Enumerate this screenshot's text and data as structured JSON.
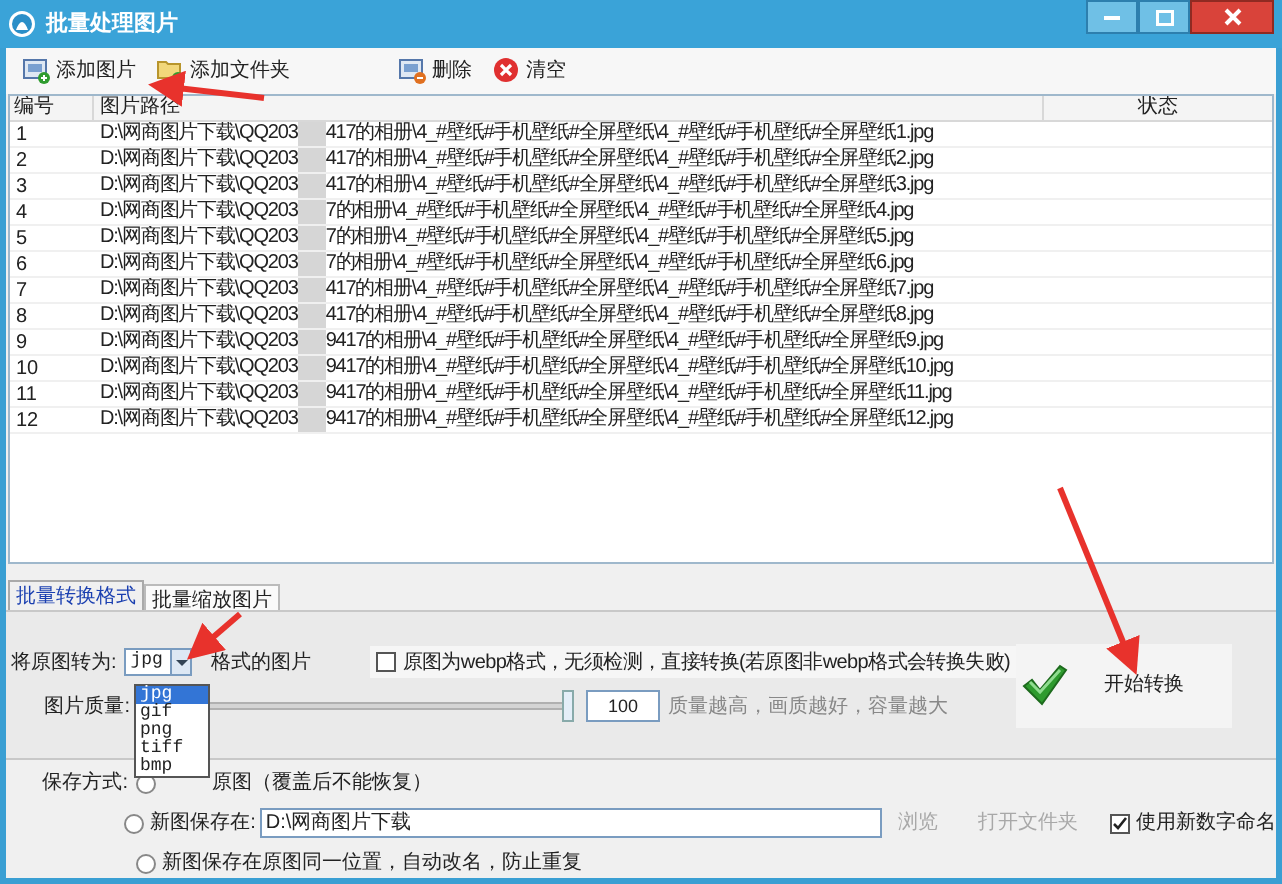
{
  "window": {
    "title": "批量处理图片"
  },
  "toolbar": [
    {
      "label": "添加图片",
      "kind": "image"
    },
    {
      "label": "添加文件夹",
      "kind": "folder"
    },
    {
      "label": "删除",
      "kind": "delete"
    },
    {
      "label": "清空",
      "kind": "clear"
    }
  ],
  "table": {
    "columns": [
      "编号",
      "图片路径",
      "状态"
    ],
    "rows": [
      {
        "number": "1",
        "path_start": "D:\\网商图片下载\\QQ203",
        "path_end": "417的相册\\4_#壁纸#手机壁纸#全屏壁纸\\4_#壁纸#手机壁纸#全屏壁纸1.jpg"
      },
      {
        "number": "2",
        "path_start": "D:\\网商图片下载\\QQ203",
        "path_end": "417的相册\\4_#壁纸#手机壁纸#全屏壁纸\\4_#壁纸#手机壁纸#全屏壁纸2.jpg"
      },
      {
        "number": "3",
        "path_start": "D:\\网商图片下载\\QQ203",
        "path_end": "417的相册\\4_#壁纸#手机壁纸#全屏壁纸\\4_#壁纸#手机壁纸#全屏壁纸3.jpg"
      },
      {
        "number": "4",
        "path_start": "D:\\网商图片下载\\QQ203",
        "path_end": "7的相册\\4_#壁纸#手机壁纸#全屏壁纸\\4_#壁纸#手机壁纸#全屏壁纸4.jpg"
      },
      {
        "number": "5",
        "path_start": "D:\\网商图片下载\\QQ203",
        "path_end": "7的相册\\4_#壁纸#手机壁纸#全屏壁纸\\4_#壁纸#手机壁纸#全屏壁纸5.jpg"
      },
      {
        "number": "6",
        "path_start": "D:\\网商图片下载\\QQ203",
        "path_end": "7的相册\\4_#壁纸#手机壁纸#全屏壁纸\\4_#壁纸#手机壁纸#全屏壁纸6.jpg"
      },
      {
        "number": "7",
        "path_start": "D:\\网商图片下载\\QQ203",
        "path_end": "417的相册\\4_#壁纸#手机壁纸#全屏壁纸\\4_#壁纸#手机壁纸#全屏壁纸7.jpg"
      },
      {
        "number": "8",
        "path_start": "D:\\网商图片下载\\QQ203",
        "path_end": "417的相册\\4_#壁纸#手机壁纸#全屏壁纸\\4_#壁纸#手机壁纸#全屏壁纸8.jpg"
      },
      {
        "number": "9",
        "path_start": "D:\\网商图片下载\\QQ203",
        "path_end": "9417的相册\\4_#壁纸#手机壁纸#全屏壁纸\\4_#壁纸#手机壁纸#全屏壁纸9.jpg"
      },
      {
        "number": "10",
        "path_start": "D:\\网商图片下载\\QQ203",
        "path_end": "9417的相册\\4_#壁纸#手机壁纸#全屏壁纸\\4_#壁纸#手机壁纸#全屏壁纸10.jpg"
      },
      {
        "number": "11",
        "path_start": "D:\\网商图片下载\\QQ203",
        "path_end": "9417的相册\\4_#壁纸#手机壁纸#全屏壁纸\\4_#壁纸#手机壁纸#全屏壁纸11.jpg"
      },
      {
        "number": "12",
        "path_start": "D:\\网商图片下载\\QQ203",
        "path_end": "9417的相册\\4_#壁纸#手机壁纸#全屏壁纸\\4_#壁纸#手机壁纸#全屏壁纸12.jpg"
      }
    ]
  },
  "tabs": [
    {
      "label": "批量转换格式",
      "selected": true
    },
    {
      "label": "批量缩放图片",
      "selected": false
    }
  ],
  "convert": {
    "label": "将原图转为:",
    "format": "jpg",
    "format_suffix": "格式的图片",
    "webp_option": {
      "label": "原图为webp格式，无须检测，直接转换(若原图非webp格式会转换失败)",
      "checked": false
    },
    "quality_label": "图片质量:",
    "quality": {
      "level": 1
    },
    "quality_value": "100",
    "quality_hint": "质量越高，画质越好，容量越大",
    "start_button": "开始转换"
  },
  "format_dropdown": [
    {
      "label": "jpg",
      "selected": true
    },
    {
      "label": "gif",
      "selected": false
    },
    {
      "label": "png",
      "selected": false
    },
    {
      "label": "tiff",
      "selected": false
    },
    {
      "label": "bmp",
      "selected": false
    }
  ],
  "save": {
    "label": "保存方式:",
    "options": [
      {
        "label": "原图（覆盖后不能恢复）",
        "selected": false
      },
      {
        "label": "新图保存在:",
        "selected": false,
        "path": "D:\\网商图片下载"
      },
      {
        "label": "新图保存在原图同一位置，自动改名，防止重复",
        "selected": false
      }
    ],
    "browse": {
      "label": "浏览",
      "disabled": true
    },
    "open_folder": {
      "label": "打开文件夹",
      "disabled": true
    },
    "numeric_naming": {
      "label": "使用新数字命名",
      "checked": true
    }
  }
}
